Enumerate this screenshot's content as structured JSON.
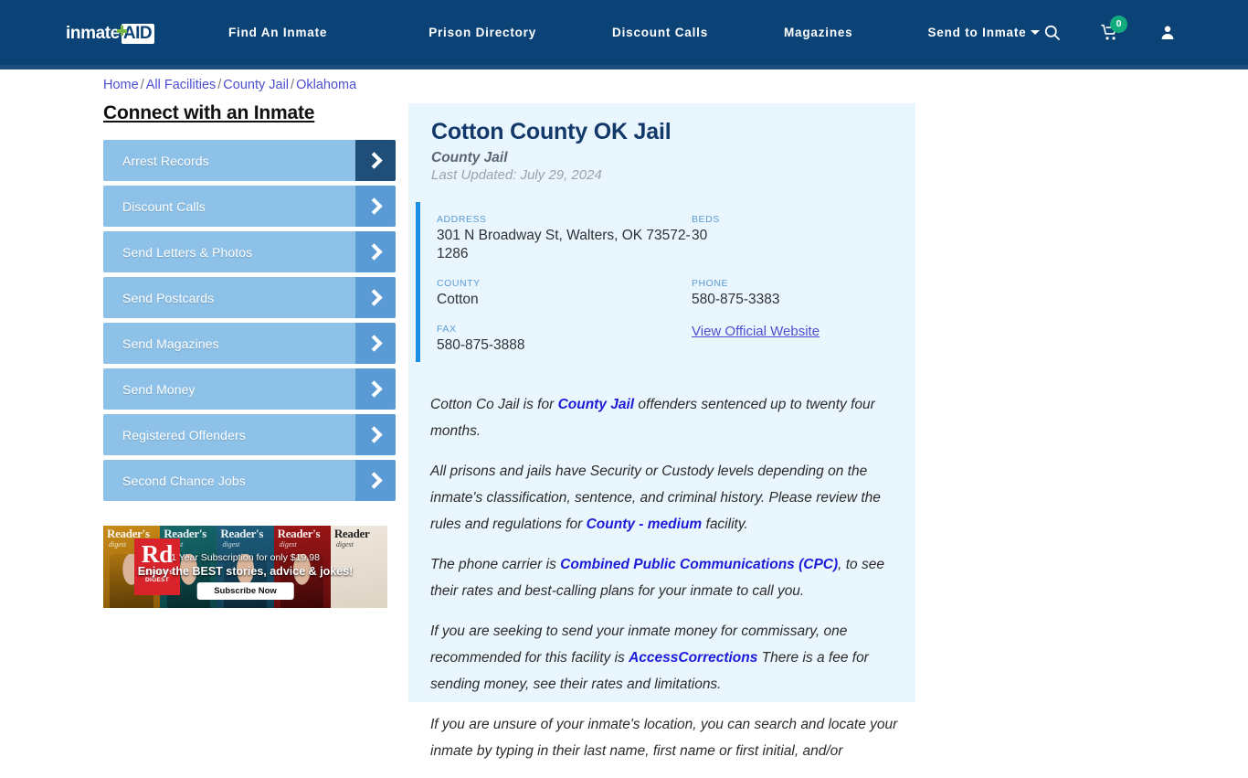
{
  "header": {
    "logo": {
      "word": "inmate",
      "aid": "AID",
      "plus_icon": "green-plus-icon"
    },
    "nav": [
      {
        "label": "Find An Inmate"
      },
      {
        "label": "Prison Directory"
      },
      {
        "label": "Discount Calls"
      },
      {
        "label": "Magazines"
      },
      {
        "label": "Send to Inmate",
        "has_dropdown": true
      }
    ],
    "icons": {
      "search": "search-icon",
      "cart": "shopping-cart-icon",
      "cart_badge": "0",
      "account": "user-account-icon"
    },
    "bg_color": "#0c4377"
  },
  "breadcrumb": {
    "items": [
      "Home",
      "All Facilities",
      "County Jail",
      "Oklahoma"
    ],
    "separator": "/"
  },
  "sidebar": {
    "title": "Connect with an Inmate",
    "items": [
      {
        "label": "Arrest Records",
        "active": true
      },
      {
        "label": "Discount Calls",
        "active": false
      },
      {
        "label": "Send Letters & Photos",
        "active": false
      },
      {
        "label": "Send Postcards",
        "active": false
      },
      {
        "label": "Send Magazines",
        "active": false
      },
      {
        "label": "Send Money",
        "active": false
      },
      {
        "label": "Registered Offenders",
        "active": false
      },
      {
        "label": "Second Chance Jobs",
        "active": false
      }
    ],
    "ad": {
      "brand": "Rd",
      "brand_sub": "READER'S DIGEST",
      "line1": "1 Year Subscription for only $19.98",
      "line2": "Enjoy the BEST stories, advice & jokes!",
      "cta": "Subscribe Now",
      "covers": [
        {
          "title": "Reader's",
          "sub": "digest"
        },
        {
          "title": "Reader's",
          "sub": "digest"
        },
        {
          "title": "Reader's",
          "sub": "digest"
        },
        {
          "title": "Reader's",
          "sub": "digest"
        },
        {
          "title": "Reader",
          "sub": "digest"
        }
      ]
    }
  },
  "facility": {
    "name": "Cotton County OK Jail",
    "type": "County Jail",
    "last_updated": "Last Updated: July 29, 2024",
    "fields": {
      "address_label": "ADDRESS",
      "address_value": "301 N Broadway St, Walters, OK 73572-1286",
      "beds_label": "BEDS",
      "beds_value": "30",
      "county_label": "COUNTY",
      "county_value": "Cotton",
      "phone_label": "PHONE",
      "phone_value": "580-875-3383",
      "fax_label": "FAX",
      "fax_value": "580-875-3888",
      "website_link": "View Official Website"
    }
  },
  "body": {
    "p1_a": "Cotton Co Jail is for ",
    "p1_b": "County Jail",
    "p1_c": " offenders sentenced up to twenty four months.",
    "p2_a": "All prisons and jails have Security or Custody levels depending on the inmate's classification, sentence, and criminal history. Please review the rules and regulations for ",
    "p2_b": "County - medium",
    "p2_c": " facility.",
    "p3_a": "The phone carrier is ",
    "p3_b": "Combined Public Communications (CPC)",
    "p3_c": ", to see their rates and best-calling plans for your inmate to call you.",
    "p4_a": "If you are seeking to send your inmate money for commissary, one recommended for this facility is ",
    "p4_b": "AccessCorrections",
    "p4_c": " There is a fee for sending money, see their rates and limitations.",
    "p5_a": "If you are unsure of your inmate's location, you can search and locate your inmate by typing in their last name, first name or first initial, and/or"
  }
}
